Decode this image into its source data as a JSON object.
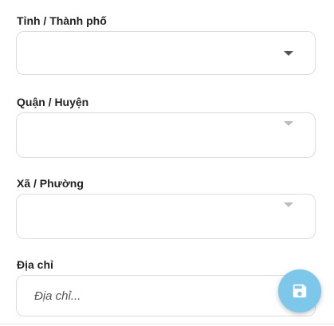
{
  "form": {
    "province": {
      "label": "Tỉnh / Thành phố",
      "value": ""
    },
    "district": {
      "label": "Quận / Huyện",
      "value": ""
    },
    "ward": {
      "label": "Xã / Phường",
      "value": ""
    },
    "address": {
      "label": "Địa chỉ",
      "placeholder": "Địa chỉ...",
      "value": ""
    }
  },
  "fab": {
    "icon": "save-icon",
    "color": "#7cc7ea"
  }
}
